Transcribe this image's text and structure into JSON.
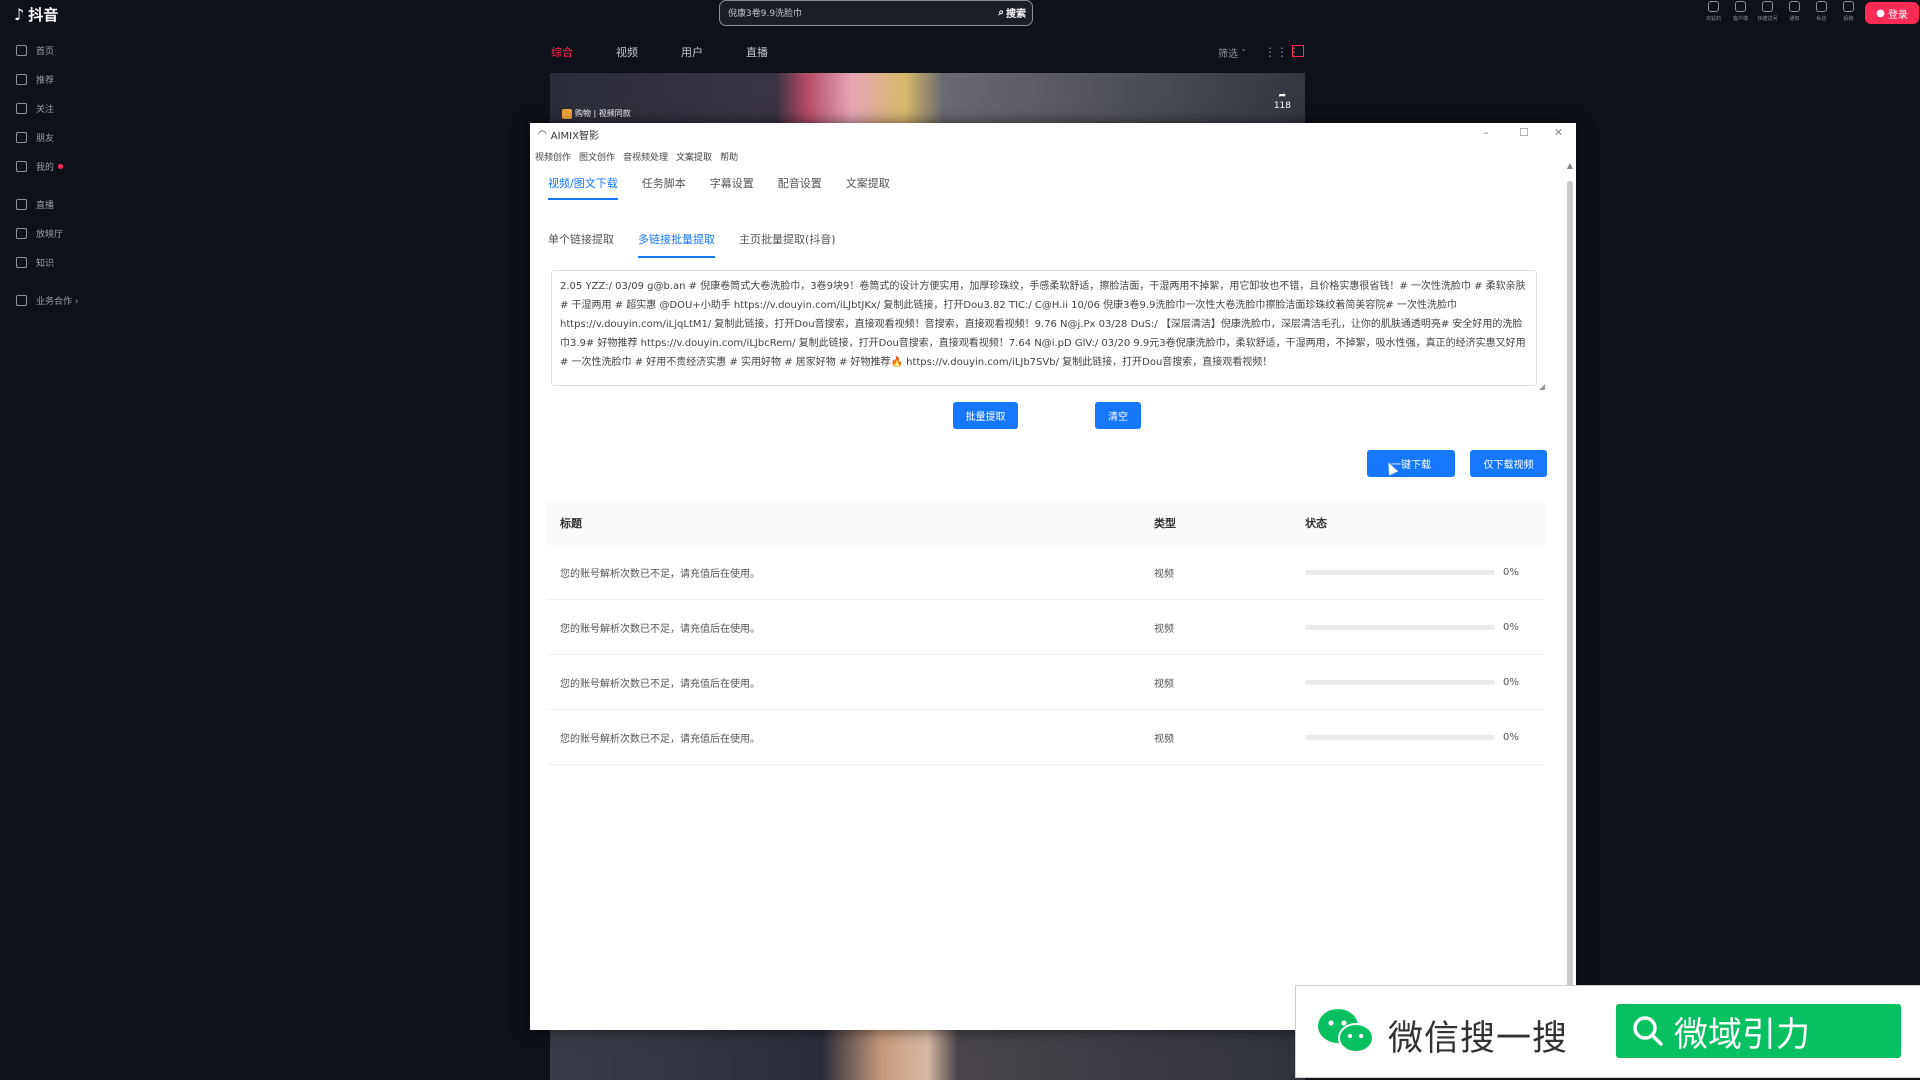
{
  "douyin": {
    "logo": "抖音",
    "search_query": "倪康3卷9.9洗脸巾",
    "search_button": "搜索",
    "top_icons": [
      "充钻石",
      "客户端",
      "快捷访问",
      "通知",
      "私信",
      "投稿"
    ],
    "login": "登录",
    "sidebar": [
      {
        "label": "首页",
        "icon": "home-icon"
      },
      {
        "label": "推荐",
        "icon": "recommend-icon"
      },
      {
        "label": "关注",
        "icon": "follow-icon"
      },
      {
        "label": "朋友",
        "icon": "friends-icon"
      },
      {
        "label": "我的",
        "icon": "profile-icon"
      },
      {
        "label": "直播",
        "icon": "live-icon"
      },
      {
        "label": "放映厅",
        "icon": "cinema-icon"
      },
      {
        "label": "知识",
        "icon": "knowledge-icon"
      },
      {
        "label": "业务合作 ›",
        "icon": "business-icon"
      }
    ],
    "tabs": [
      "综合",
      "视频",
      "用户",
      "直播"
    ],
    "filter": "筛选 ˇ",
    "video_caption": "购物 | 视频同款",
    "video_count": "118"
  },
  "app": {
    "title": "AIMIX智影",
    "menu": [
      "视频创作",
      "图文创作",
      "音视频处理",
      "文案提取",
      "帮助"
    ],
    "main_tabs": [
      "视频/图文下载",
      "任务脚本",
      "字幕设置",
      "配音设置",
      "文案提取"
    ],
    "sub_tabs": [
      "单个链接提取",
      "多链接批量提取",
      "主页批量提取(抖音)"
    ],
    "links_text": "2.05 YZZ:/ 03/09 g@b.an # 倪康卷筒式大卷洗脸巾，3卷9块9！卷筒式的设计方便实用，加厚珍珠纹，手感柔软舒适，擦脸洁面，干湿两用不掉絮，用它卸妆也不错，且价格实惠很省钱！# 一次性洗脸巾 # 柔软亲肤 # 干湿两用 # 超实惠 @DOU+小助手 https://v.douyin.com/iLJbtJKx/ 复制此链接，打开Dou3.82 TIC:/ C@H.ii 10/06 倪康3卷9.9洗脸巾一次性大卷洗脸巾擦脸洁面珍珠纹着简美容院# 一次性洗脸巾 https://v.douyin.com/iLjqLtM1/ 复制此链接，打开Dou音搜索，直接观看视频！音搜索，直接观看视频！9.76 N@j.Px 03/28 DuS:/ 【深层清洁】倪康洗脸巾，深层清洁毛孔，让你的肌肤通透明亮# 安全好用的洗脸巾3.9# 好物推荐 https://v.douyin.com/iLJbcRem/ 复制此链接，打开Dou音搜索，直接观看视频！7.64 N@i.pD GlV:/ 03/20 9.9元3卷倪康洗脸巾，柔软舒适，干湿两用，不掉絮，吸水性强，真正的经济实惠又好用 # 一次性洗脸巾 # 好用不贵经济实惠 # 实用好物 # 居家好物 # 好物推荐🔥 https://v.douyin.com/iLJb7SVb/ 复制此链接，打开Dou音搜索，直接观看视频！",
    "batch_extract_button": "批量提取",
    "clear_button": "清空",
    "download_button": "一键下载",
    "download_video_button": "仅下载视频",
    "table": {
      "headers": [
        "标题",
        "类型",
        "状态"
      ],
      "rows": [
        {
          "title": "您的账号解析次数已不足，请充值后在使用。",
          "type": "视频",
          "progress": 0,
          "pct": "0%"
        },
        {
          "title": "您的账号解析次数已不足，请充值后在使用。",
          "type": "视频",
          "progress": 0,
          "pct": "0%"
        },
        {
          "title": "您的账号解析次数已不足，请充值后在使用。",
          "type": "视频",
          "progress": 0,
          "pct": "0%"
        },
        {
          "title": "您的账号解析次数已不足，请充值后在使用。",
          "type": "视频",
          "progress": 0,
          "pct": "0%"
        }
      ]
    }
  },
  "banner": {
    "text": "微信搜一搜",
    "search_term": "微域引力",
    "color": "#07c160"
  },
  "colors": {
    "douyin_red": "#fe2c55",
    "accent_blue": "#1677ff"
  }
}
